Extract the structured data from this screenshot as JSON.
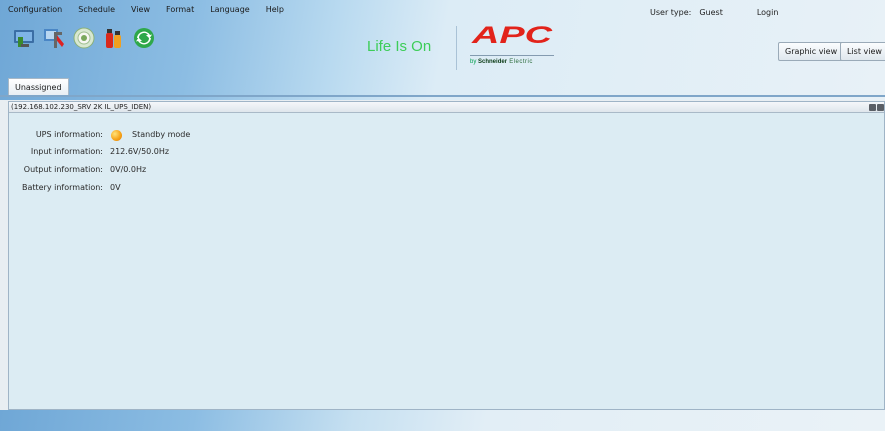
{
  "menubar": {
    "items": [
      "Configuration",
      "Schedule",
      "View",
      "Format",
      "Language",
      "Help"
    ]
  },
  "user": {
    "type_label": "User type:",
    "type_value": "Guest",
    "login_label": "Login"
  },
  "toolbar": {
    "icons": [
      "monitor-icon",
      "tools-icon",
      "disc-icon",
      "fire-extinguisher-icon",
      "refresh-icon"
    ]
  },
  "brand": {
    "tagline": "Life Is On",
    "logo": "APC",
    "byline_prefix": "by ",
    "byline_company": "Schneider",
    "byline_suffix": " Electric",
    "logo_color": "#e2231a",
    "tagline_color": "#3dcd58"
  },
  "views": {
    "graphic": "Graphic view",
    "list": "List view"
  },
  "tabs": {
    "group": "Unassigned"
  },
  "device": {
    "title": "(192.168.102.230_SRV 2K IL_UPS_IDEN)",
    "ups_label": "UPS information:",
    "ups_value": "Standby mode",
    "input_label": "Input information:",
    "input_value": "212.6V/50.0Hz",
    "output_label": "Output information:",
    "output_value": "0V/0.0Hz",
    "battery_label": "Battery information:",
    "battery_value": "0V",
    "status_color": "#f7a51c"
  }
}
